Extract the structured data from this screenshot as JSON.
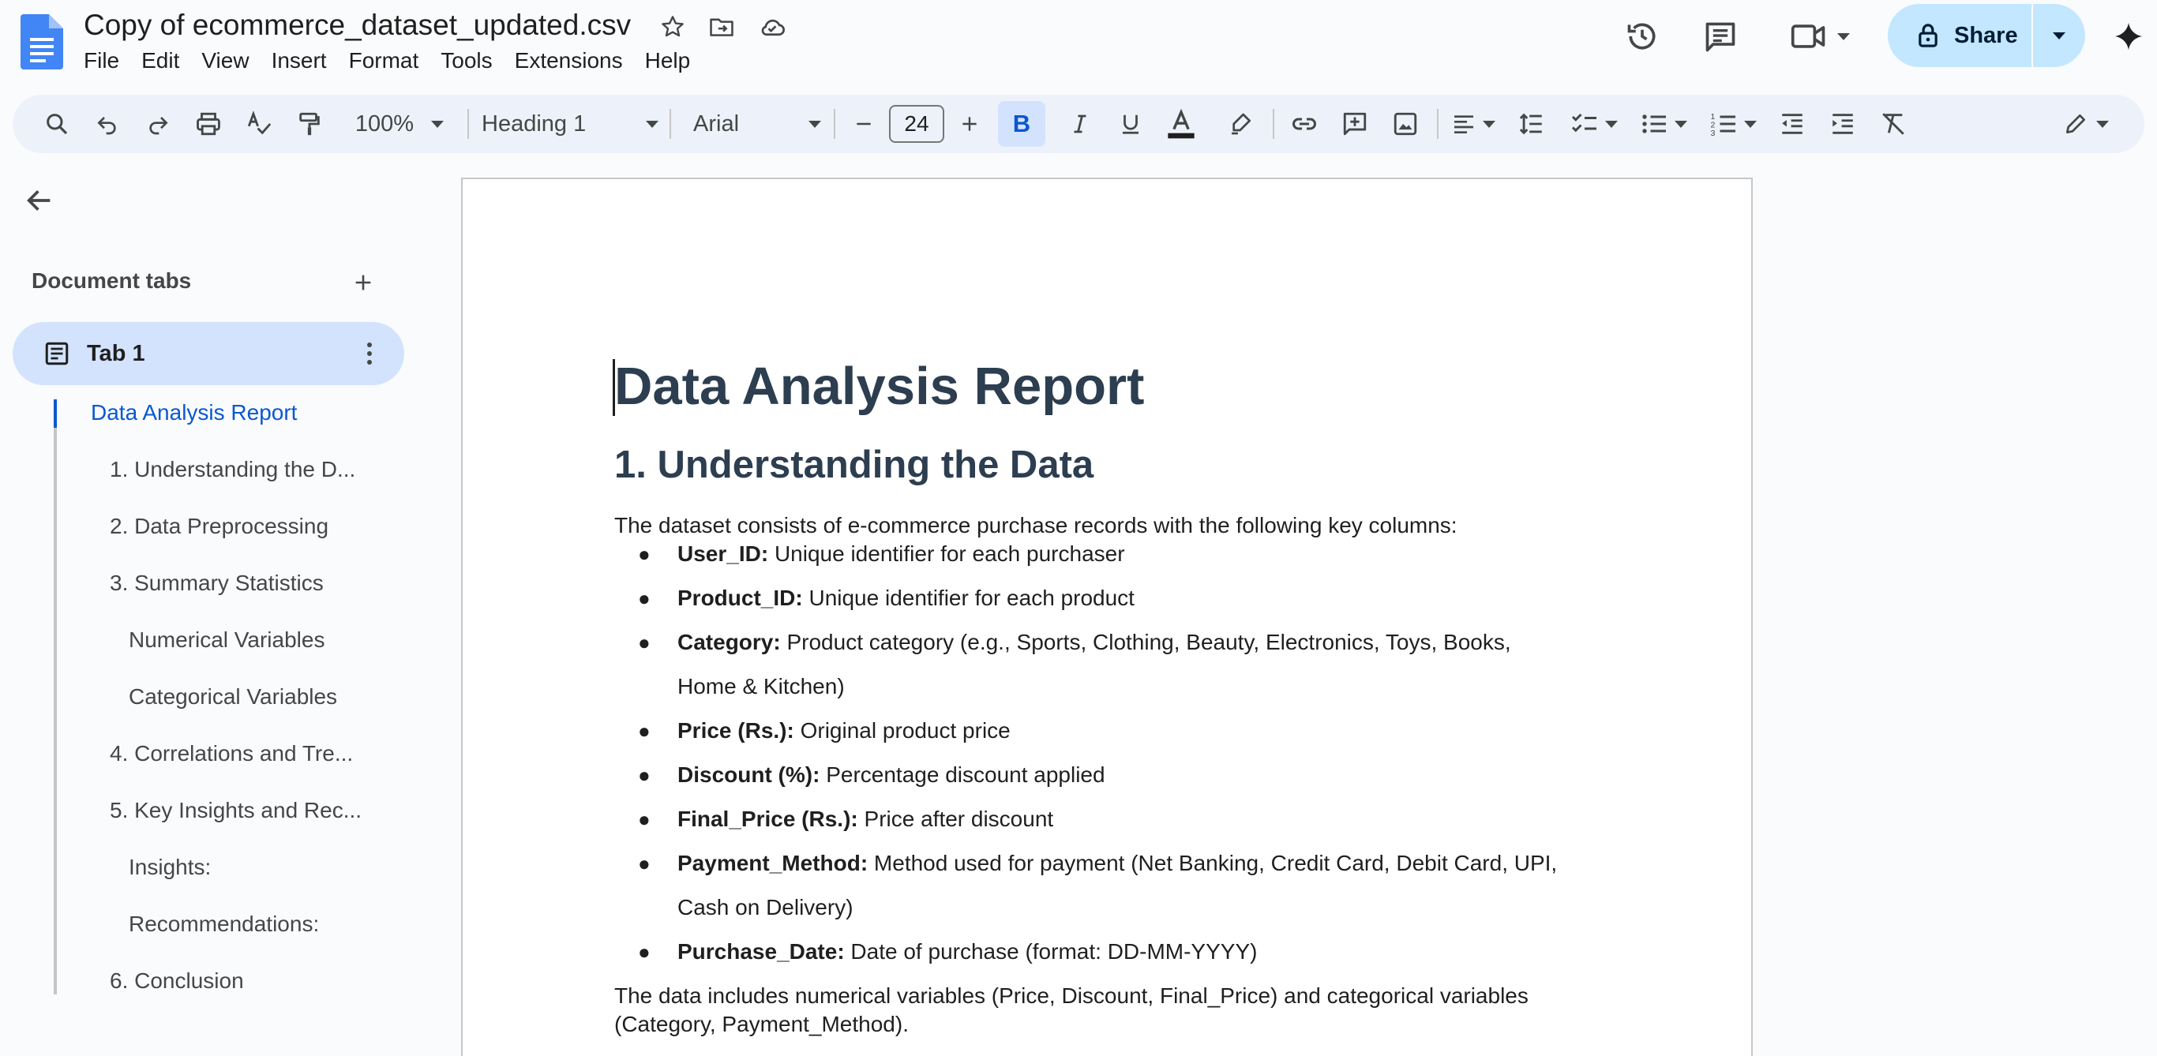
{
  "app": {
    "doc_title": "Copy of ecommerce_dataset_updated.csv",
    "share_label": "Share"
  },
  "menu": [
    "File",
    "Edit",
    "View",
    "Insert",
    "Format",
    "Tools",
    "Extensions",
    "Help"
  ],
  "toolbar": {
    "zoom": "100%",
    "style": "Heading 1",
    "font": "Arial",
    "font_size": "24",
    "bold_label": "B"
  },
  "sidebar": {
    "section_label": "Document tabs",
    "tab_label": "Tab 1",
    "outline": [
      "Data Analysis Report",
      "1. Understanding the D...",
      "2. Data Preprocessing",
      "3. Summary Statistics",
      "Numerical Variables",
      "Categorical Variables",
      "4. Correlations and Tre...",
      "5. Key Insights and Rec...",
      "Insights:",
      "Recommendations:",
      "6. Conclusion"
    ]
  },
  "document": {
    "title": "Data Analysis Report",
    "section1": "1. Understanding the Data",
    "intro": "The dataset consists of e-commerce purchase records with the following key columns:",
    "bullets": [
      {
        "term": "User_ID:",
        "desc": " Unique identifier for each purchaser"
      },
      {
        "term": "Product_ID:",
        "desc": " Unique identifier for each product"
      },
      {
        "term": "Category:",
        "desc": " Product category (e.g., Sports, Clothing, Beauty, Electronics, Toys, Books,",
        "cont": "Home & Kitchen)"
      },
      {
        "term": "Price (Rs.):",
        "desc": " Original product price"
      },
      {
        "term": "Discount (%):",
        "desc": " Percentage discount applied"
      },
      {
        "term": "Final_Price (Rs.):",
        "desc": " Price after discount"
      },
      {
        "term": "Payment_Method:",
        "desc": " Method used for payment (Net Banking, Credit Card, Debit Card, UPI,",
        "cont": "Cash on Delivery)"
      },
      {
        "term": "Purchase_Date:",
        "desc": " Date of purchase (format: DD-MM-YYYY)"
      }
    ],
    "closing_line1": "The data includes numerical variables (Price, Discount, Final_Price) and categorical variables",
    "closing_line2": "(Category, Payment_Method)."
  },
  "colors": {
    "accent": "#0b57d0",
    "heading": "#2c3e50",
    "share_bg": "#c2e7ff",
    "selected_tab": "#d3e3fd"
  },
  "icons": [
    "docs-logo-icon",
    "star-icon",
    "move-to-folder-icon",
    "cloud-saved-icon",
    "history-icon",
    "comments-icon",
    "meet-icon",
    "lock-icon",
    "gemini-icon",
    "search-menus-icon",
    "undo-icon",
    "redo-icon",
    "print-icon",
    "spellcheck-icon",
    "paint-format-icon",
    "text-color-icon",
    "highlight-icon",
    "link-icon",
    "add-comment-icon",
    "insert-image-icon",
    "align-icon",
    "line-spacing-icon",
    "checklist-icon",
    "bulleted-list-icon",
    "numbered-list-icon",
    "decrease-indent-icon",
    "increase-indent-icon",
    "clear-formatting-icon",
    "editing-mode-icon",
    "back-arrow-icon",
    "add-tab-icon",
    "tab-document-icon",
    "more-vert-icon"
  ]
}
